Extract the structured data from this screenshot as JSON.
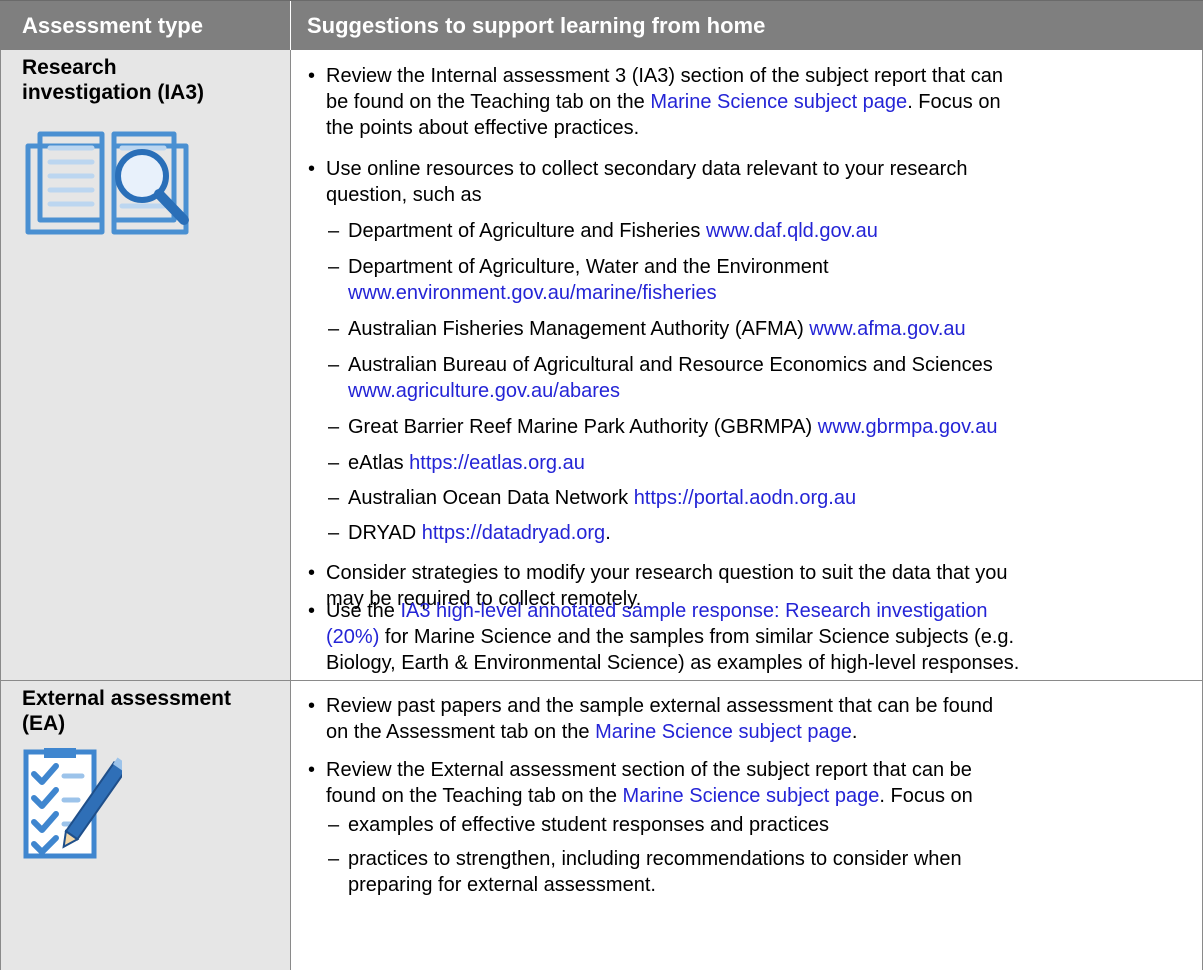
{
  "header": {
    "col1": "Assessment type",
    "col2": "Suggestions to support learning from home"
  },
  "rows": [
    {
      "title_line1": "Research",
      "title_line2": "investigation (IA3)",
      "icon": "book-magnifier-icon",
      "items": {
        "b1_l1": "Review the Internal assessment 3 (IA3) section of the subject report that can",
        "b1_l2a": "be found on the Teaching tab on the ",
        "b1_l2_link": "Marine Science subject page",
        "b1_l2b": ". Focus on",
        "b1_l3": "the points about effective practices.",
        "b2_l1": "Use online resources to collect secondary data relevant to your research",
        "b2_l2": "question, such as",
        "s1a": "Department of Agriculture and Fisheries ",
        "s1_link": "www.daf.qld.gov.au",
        "s2a": "Department of Agriculture, Water and the Environment",
        "s2_link": "www.environment.gov.au/marine/fisheries",
        "s3a": "Australian Fisheries Management Authority (AFMA) ",
        "s3_link": "www.afma.gov.au",
        "s4a": "Australian Bureau of Agricultural and Resource Economics and Sciences",
        "s4_link": "www.agriculture.gov.au/abares",
        "s5a": "Great Barrier Reef Marine Park Authority (GBRMPA) ",
        "s5_link": "www.gbrmpa.gov.au",
        "s6a": "eAtlas ",
        "s6_link": "https://eatlas.org.au",
        "s7a": "Australian Ocean Data Network ",
        "s7_link": "https://portal.aodn.org.au",
        "s8a": "DRYAD ",
        "s8_link": "https://datadryad.org",
        "s8b": ".",
        "b3_l1": "Consider strategies to modify your research question to suit the data that you",
        "b3_l2": "may be required to collect remotely.",
        "b4_l1a": "Use the ",
        "b4_l1_link": "IA3 high-level annotated sample response: Research investigation",
        "b4_l2_link": "(20%)",
        "b4_l2b": " for Marine Science and the samples from similar Science subjects (e.g.",
        "b4_l3": "Biology, Earth & Environmental Science) as examples of high-level responses."
      }
    },
    {
      "title_line1": "External assessment",
      "title_line2": "(EA)",
      "icon": "checklist-pen-icon",
      "items": {
        "b1_l1": "Review past papers and the sample external assessment that can be found",
        "b1_l2a": "on the Assessment tab on the ",
        "b1_l2_link": "Marine Science subject page",
        "b1_l2b": ".",
        "b2_l1": "Review the External assessment section of the subject report that can be",
        "b2_l2a": "found on the Teaching tab on the ",
        "b2_l2_link": "Marine Science subject page",
        "b2_l2b": ". Focus on",
        "s1": "examples of effective student responses and practices",
        "s2_l1": "practices to strengthen, including recommendations to consider when",
        "s2_l2": "preparing for external assessment."
      }
    }
  ],
  "glyphs": {
    "bullet": "•",
    "dash": "–"
  }
}
